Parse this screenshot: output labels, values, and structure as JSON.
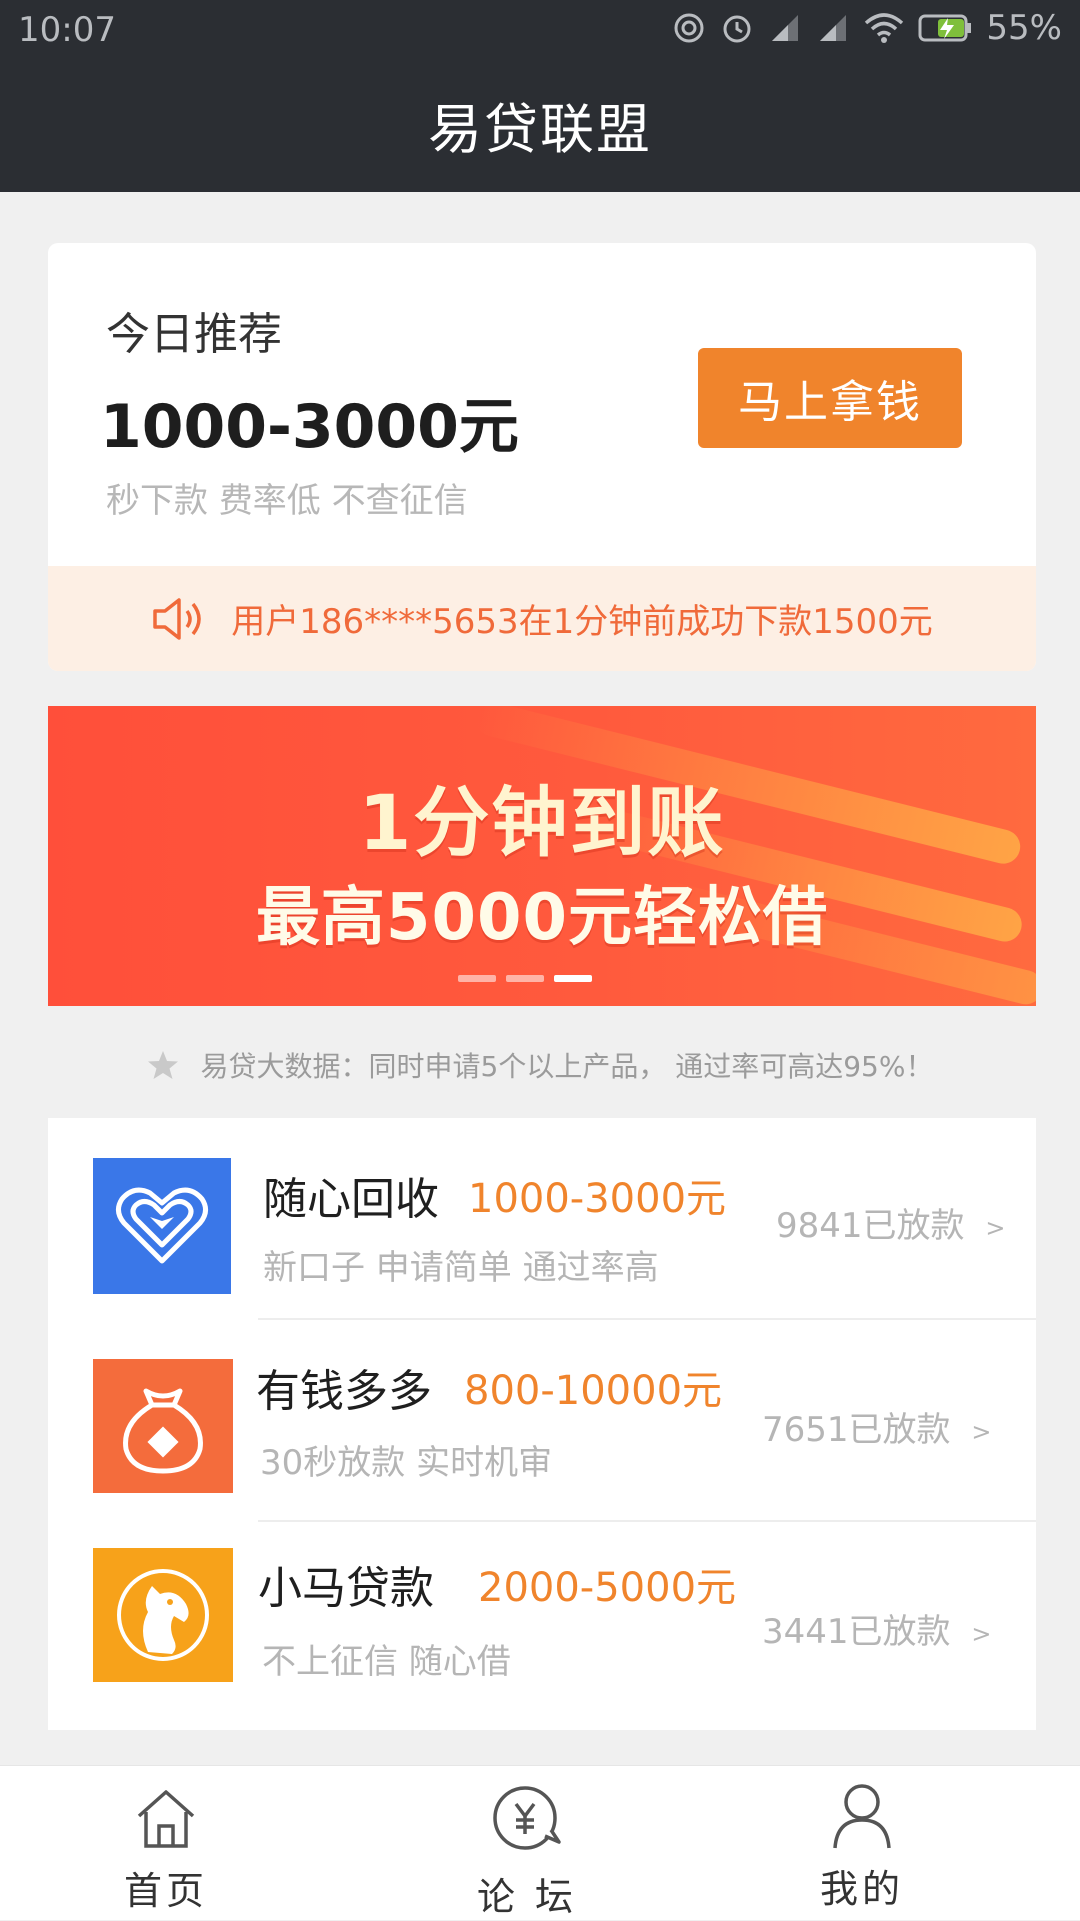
{
  "status_bar": {
    "time": "10:07",
    "battery": "55%"
  },
  "header": {
    "title": "易贷联盟"
  },
  "recommend": {
    "label": "今日推荐",
    "amount": "1000-3000元",
    "desc": "秒下款 费率低 不查征信",
    "button": "马上拿钱"
  },
  "notice": {
    "text": "用户186****5653在1分钟前成功下款1500元"
  },
  "banner": {
    "line1": "1分钟到账",
    "line2": "最高5000元轻松借",
    "dots": 3,
    "active_dot": 2
  },
  "tip": {
    "text": "易贷大数据：同时申请5个以上产品， 通过率可高达95%！"
  },
  "products": [
    {
      "name": "随心回收",
      "range": "1000-3000元",
      "desc": "新口子 申请简单 通过率高",
      "count": "9841已放款",
      "arrow": ">",
      "logo_color": "#3a77e8",
      "icon": "heart-icon"
    },
    {
      "name": "有钱多多",
      "range": "800-10000元",
      "desc": "30秒放款 实时机审",
      "count": "7651已放款",
      "arrow": ">",
      "logo_color": "#f46c3c",
      "icon": "money-bag-icon"
    },
    {
      "name": "小马贷款",
      "range": "2000-5000元",
      "desc": "不上征信  随心借",
      "count": "3441已放款",
      "arrow": ">",
      "logo_color": "#f7a21a",
      "icon": "horse-icon"
    }
  ],
  "bottom_nav": [
    {
      "label": "首页",
      "icon": "home-icon"
    },
    {
      "label": "论 坛",
      "icon": "forum-yen-icon"
    },
    {
      "label": "我的",
      "icon": "user-icon"
    }
  ],
  "colors": {
    "header_bg": "#2b2e33",
    "accent_orange": "#f0842c",
    "banner_red": "#ff5a3d"
  }
}
